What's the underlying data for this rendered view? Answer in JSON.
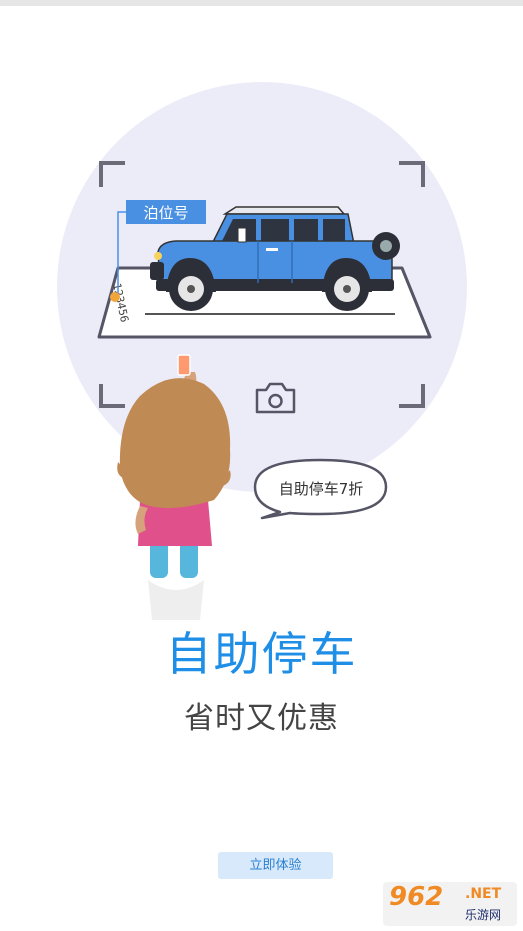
{
  "illustration": {
    "parking_label": "泊位号",
    "plate_number": "123456",
    "bubble_text": "自助停车7折"
  },
  "title": "自助停车",
  "subtitle": "省时又优惠",
  "start_button": "立即体验",
  "watermark": {
    "main": "962",
    "net": ".NET",
    "sub": "乐游网"
  },
  "colors": {
    "accent": "#1e8ee6",
    "circle": "#ececf9",
    "car": "#4a90e2",
    "button_bg": "#d7e9fb"
  }
}
